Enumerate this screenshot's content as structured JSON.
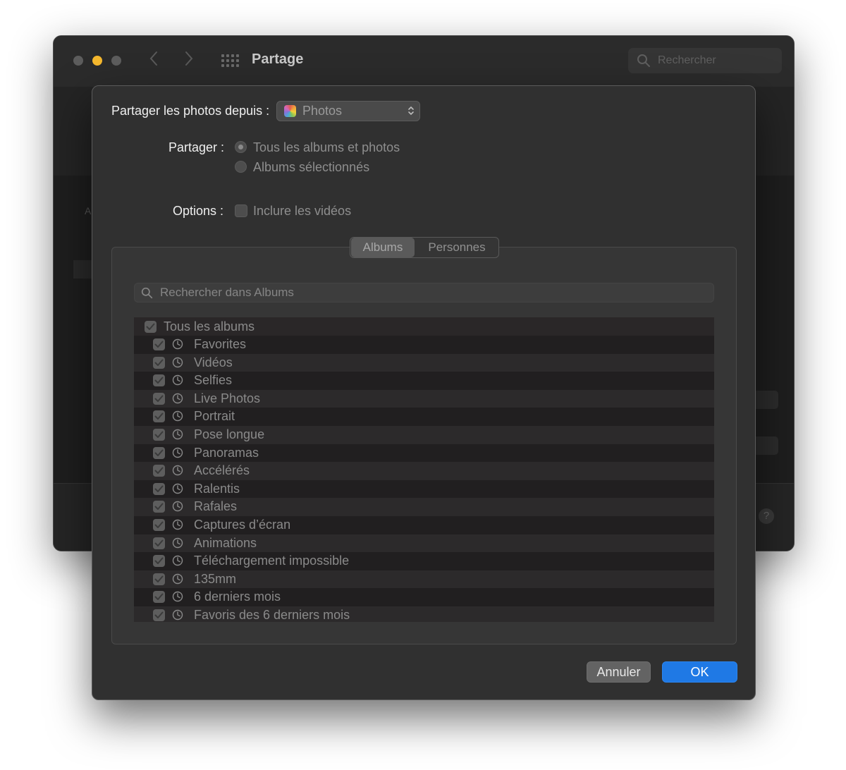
{
  "window": {
    "title": "Partage",
    "search_placeholder": "Rechercher",
    "nav_back_icon": "chevron-left-icon",
    "nav_forward_icon": "chevron-right-icon",
    "grid_icon": "show-all-grid-icon",
    "help": "?",
    "bg_fragment": "Ac"
  },
  "sheet": {
    "source_label": "Partager les photos depuis :",
    "source_value": "Photos",
    "share_label": "Partager :",
    "share_options": [
      {
        "label": "Tous les albums et photos",
        "selected": true
      },
      {
        "label": "Albums sélectionnés",
        "selected": false
      }
    ],
    "options_label": "Options :",
    "include_videos_label": "Inclure les vidéos",
    "include_videos_checked": false,
    "tabs": [
      {
        "label": "Albums",
        "active": true
      },
      {
        "label": "Personnes",
        "active": false
      }
    ],
    "album_search_placeholder": "Rechercher dans Albums",
    "all_albums_label": "Tous les albums",
    "albums": [
      "Favorites",
      "Vidéos",
      "Selfies",
      "Live Photos",
      "Portrait",
      "Pose longue",
      "Panoramas",
      "Accélérés",
      "Ralentis",
      "Rafales",
      "Captures d’écran",
      "Animations",
      "Téléchargement impossible",
      "135mm",
      "6 derniers mois",
      "Favoris des 6 derniers mois"
    ],
    "cancel_label": "Annuler",
    "ok_label": "OK"
  },
  "colors": {
    "accent": "#1f79e5",
    "traffic_yellow": "#f5b82e",
    "sheet_bg": "#303030"
  }
}
